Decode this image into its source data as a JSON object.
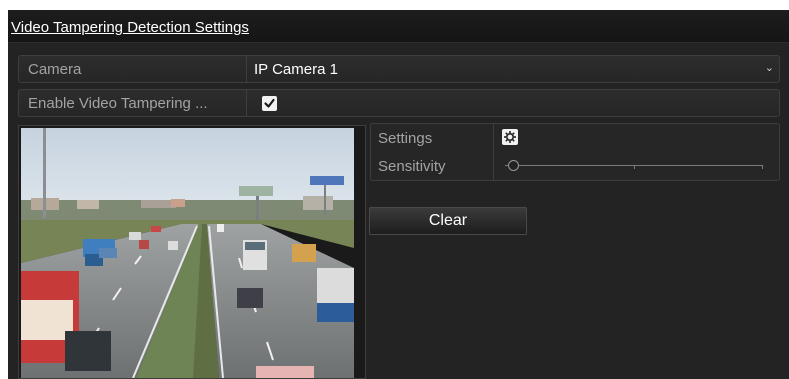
{
  "dialog": {
    "title": "Video Tampering Detection Settings"
  },
  "camera_row": {
    "label": "Camera",
    "value": "IP Camera 1",
    "dropdown_icon": "chevron-down-icon"
  },
  "enable_row": {
    "label": "Enable Video Tampering ...",
    "checked": true
  },
  "settings_panel": {
    "settings_label": "Settings",
    "settings_icon": "gear-icon",
    "sensitivity_label": "Sensitivity",
    "sensitivity_level": 0
  },
  "buttons": {
    "clear_label": "Clear"
  },
  "colors": {
    "background": "#232323",
    "title_bar": "#151515",
    "row_border": "#3e3e3e",
    "label_text": "#a3a3a3",
    "value_text": "#ffffff"
  }
}
